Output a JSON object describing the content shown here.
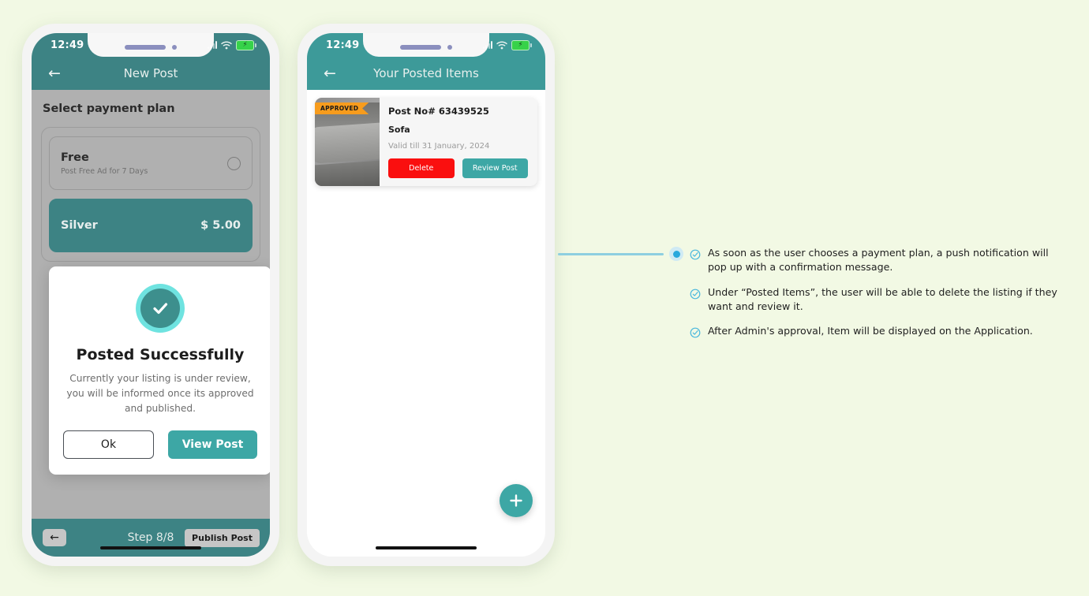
{
  "background_color": "#f2f9e4",
  "accent": {
    "teal_dark": "#3d8384",
    "teal": "#3da7a5",
    "teal_light": "#6fe3e0",
    "orange": "#f79c1d",
    "red": "#fa0f0f",
    "blue": "#29a8dc"
  },
  "phone1": {
    "status": {
      "time": "12:49",
      "battery_icon": "charging-battery-icon",
      "wifi_icon": "wifi-icon",
      "signal_icon": "signal-icon"
    },
    "appbar": {
      "title": "New Post",
      "back_icon": "back-arrow-icon"
    },
    "section_title": "Select payment plan",
    "plans": [
      {
        "name": "Free",
        "desc": "Post Free Ad for 7 Days",
        "price": "",
        "selected": false
      },
      {
        "name": "Silver",
        "desc": "",
        "price": "$ 5.00",
        "selected": true
      }
    ],
    "modal": {
      "icon": "success-check-icon",
      "title": "Posted Successfully",
      "body": "Currently your listing is under review, you will be informed once its approved and published.",
      "ok_label": "Ok",
      "view_label": "View Post"
    },
    "stepbar": {
      "back_icon": "back-arrow-icon",
      "step_label": "Step 8/8",
      "publish_label": "Publish Post"
    }
  },
  "phone2": {
    "status": {
      "time": "12:49",
      "battery_icon": "charging-battery-icon",
      "wifi_icon": "wifi-icon",
      "signal_icon": "signal-icon"
    },
    "appbar": {
      "title": "Your Posted Items",
      "back_icon": "back-arrow-icon"
    },
    "listing": {
      "badge": "APPROVED",
      "post_no": "Post No# 63439525",
      "item_name": "Sofa",
      "valid_till": "Valid till  31 January, 2024",
      "delete_label": "Delete",
      "review_label": "Review Post",
      "thumbnail": "sofa-photo"
    },
    "fab": {
      "icon": "plus-icon"
    }
  },
  "annotations": [
    {
      "icon": "check-circle-icon",
      "text": "As soon as the user chooses a payment plan, a push notification will pop up with a confirmation message."
    },
    {
      "icon": "check-circle-icon",
      "text": "Under “Posted Items”, the user will be able to delete the listing if they want and review it."
    },
    {
      "icon": "check-circle-icon",
      "text": "After Admin's approval, Item will be displayed on the Application."
    }
  ]
}
